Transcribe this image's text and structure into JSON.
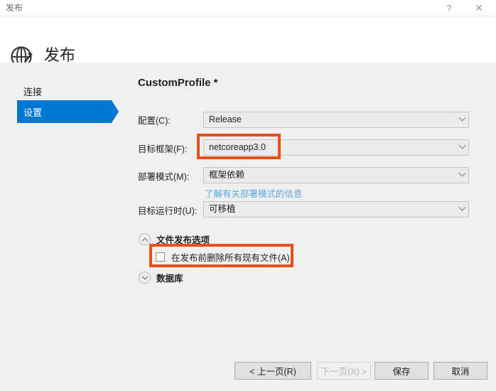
{
  "window": {
    "titlebar_text": "发布",
    "help_icon": "question-mark-icon",
    "help_glyph": "?",
    "close_icon": "close-icon",
    "close_glyph": "✕"
  },
  "header": {
    "icon": "globe-publish-icon",
    "title": "发布"
  },
  "sidebar": {
    "items": [
      {
        "label": "连接",
        "selected": false
      },
      {
        "label": "设置",
        "selected": true
      }
    ]
  },
  "main": {
    "profile_title": "CustomProfile *",
    "fields": [
      {
        "label": "配置(C):",
        "value": "Release"
      },
      {
        "label": "目标框架(F):",
        "value": "netcoreapp3.0"
      },
      {
        "label": "部署模式(M):",
        "value": "框架依赖"
      },
      {
        "label": "目标运行时(U):",
        "value": "可移植"
      }
    ],
    "deployment_hint_link": "了解有关部署模式的信息",
    "sections": [
      {
        "label": "文件发布选项",
        "state": "expanded",
        "icon": "chevron-up-icon"
      },
      {
        "label": "数据库",
        "state": "collapsed",
        "icon": "chevron-down-icon"
      }
    ],
    "checkbox": {
      "label": "在发布前删除所有现有文件(A)",
      "checked": false
    }
  },
  "footer": {
    "buttons": [
      {
        "label": "< 上一页(R)",
        "disabled": false
      },
      {
        "label": "下一页(X) >",
        "disabled": true
      },
      {
        "label": "保存",
        "disabled": false
      },
      {
        "label": "取消",
        "disabled": false
      }
    ]
  },
  "annotations": {
    "color": "#E8501A",
    "boxes": [
      {
        "target": "target-framework-combo"
      },
      {
        "target": "delete-existing-files-checkbox"
      }
    ]
  },
  "colors": {
    "accent": "#0078D4",
    "annotation": "#E8501A",
    "link": "#5AA7E0",
    "body_bg": "#F0F0F0"
  }
}
